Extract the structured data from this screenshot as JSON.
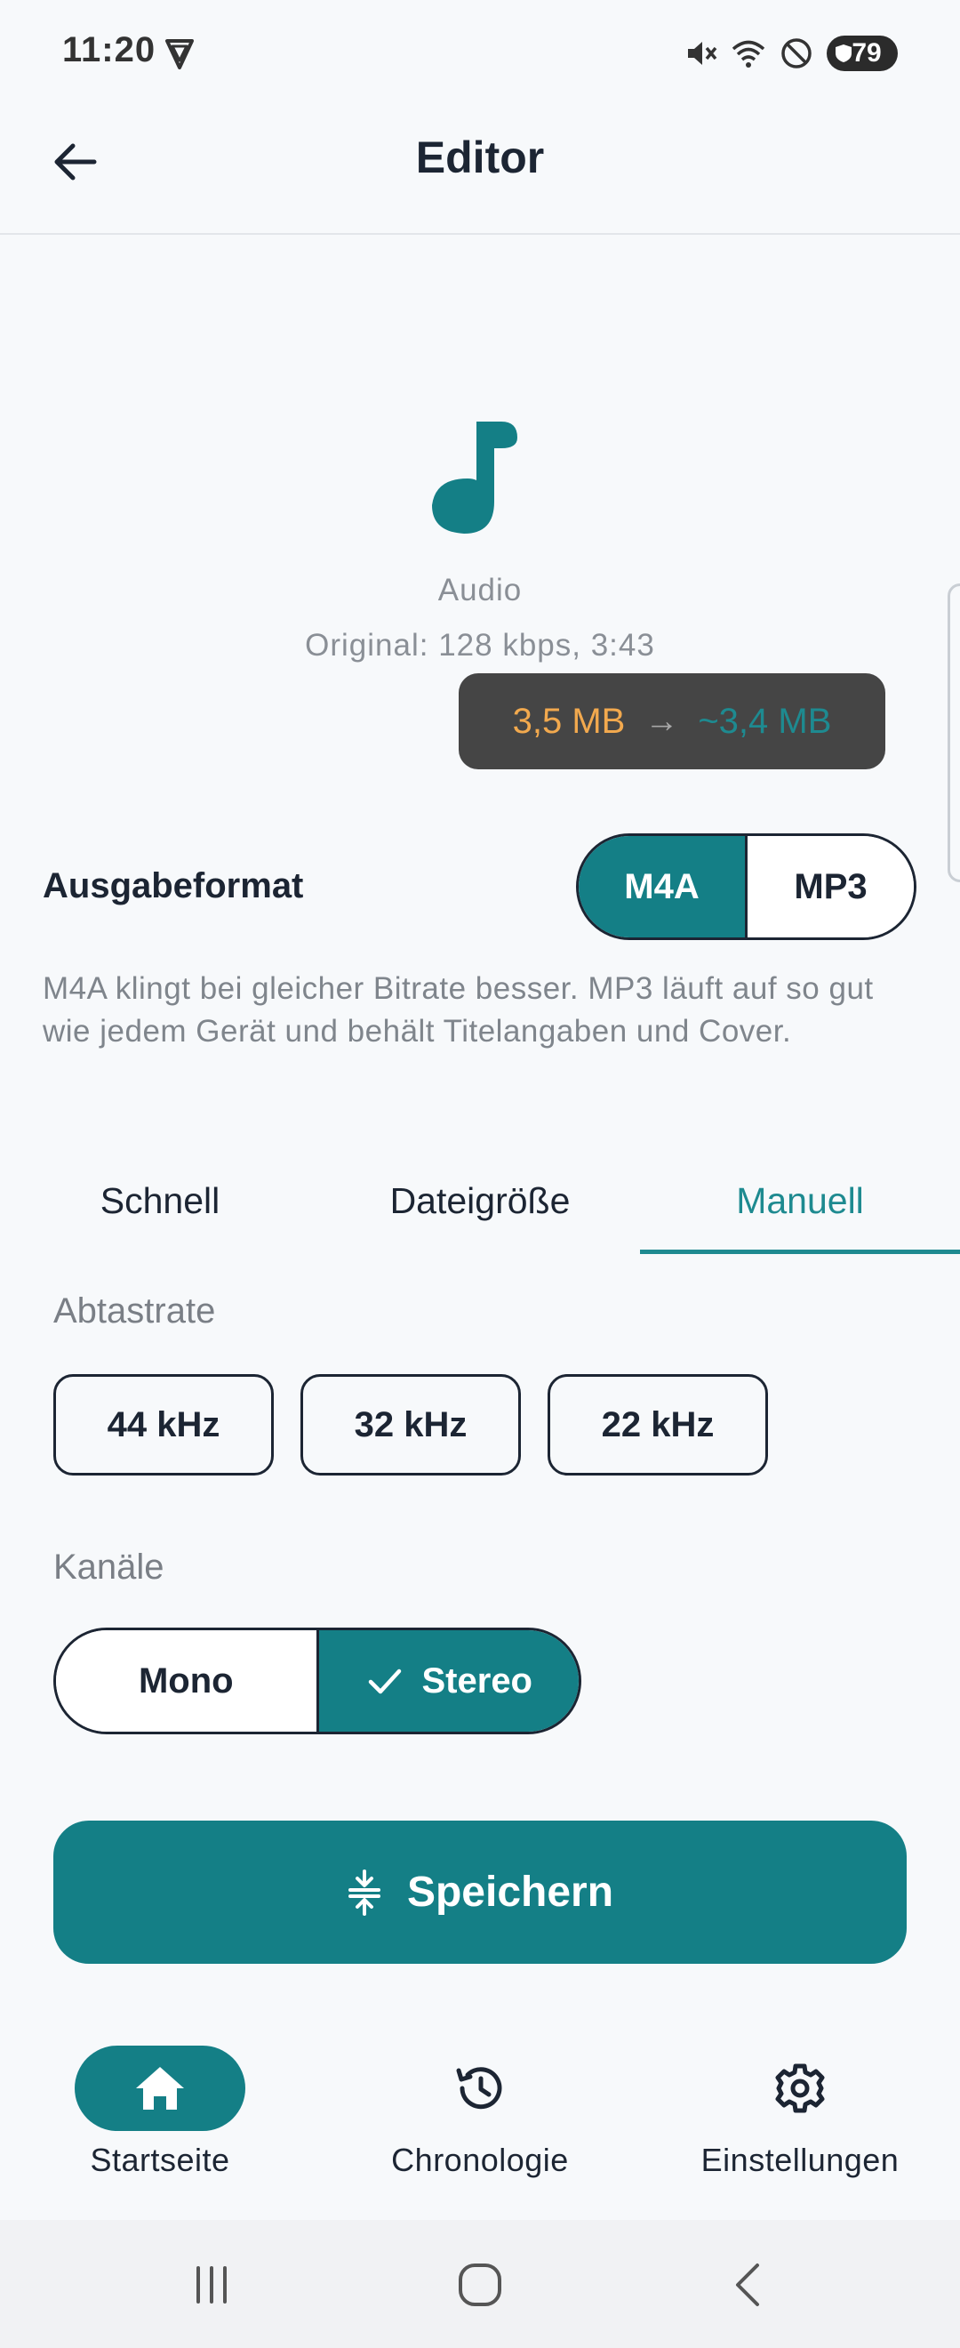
{
  "status_bar": {
    "time": "11:20",
    "battery": "79",
    "icons": [
      "vpn-shield-icon",
      "mute-icon",
      "wifi-icon",
      "do-not-disturb-icon",
      "battery-icon"
    ]
  },
  "app_bar": {
    "title": "Editor",
    "back_icon": "arrow-left-icon"
  },
  "media": {
    "icon": "music-note-icon",
    "type": "Audio",
    "original": "Original: 128 kbps, 3:43",
    "size_from": "3,5 MB",
    "size_arrow": "→",
    "size_to": "~3,4 MB"
  },
  "output_format": {
    "label": "Ausgabeformat",
    "options": [
      "M4A",
      "MP3"
    ],
    "selected": "M4A",
    "description": "M4A klingt bei gleicher Bitrate besser. MP3 läuft auf so gut wie jedem Gerät und behält Titelangaben und Cover."
  },
  "tabs": {
    "items": [
      "Schnell",
      "Dateigröße",
      "Manuell"
    ],
    "active": "Manuell"
  },
  "sample_rate": {
    "label": "Abtastrate",
    "options": [
      "44 kHz",
      "32 kHz",
      "22 kHz"
    ]
  },
  "channels": {
    "label": "Kanäle",
    "options": [
      "Mono",
      "Stereo"
    ],
    "selected": "Stereo"
  },
  "save_button": {
    "label": "Speichern",
    "icon": "compress-icon"
  },
  "bottom_nav": {
    "items": [
      {
        "label": "Startseite",
        "icon": "home-icon"
      },
      {
        "label": "Chronologie",
        "icon": "history-icon"
      },
      {
        "label": "Einstellungen",
        "icon": "gear-icon"
      }
    ],
    "active": "Startseite"
  },
  "colors": {
    "accent": "#147f86",
    "accent_text": "#1e8a90",
    "size_from": "#f2a94e",
    "background": "#f7f9fb",
    "text": "#1c2533"
  }
}
